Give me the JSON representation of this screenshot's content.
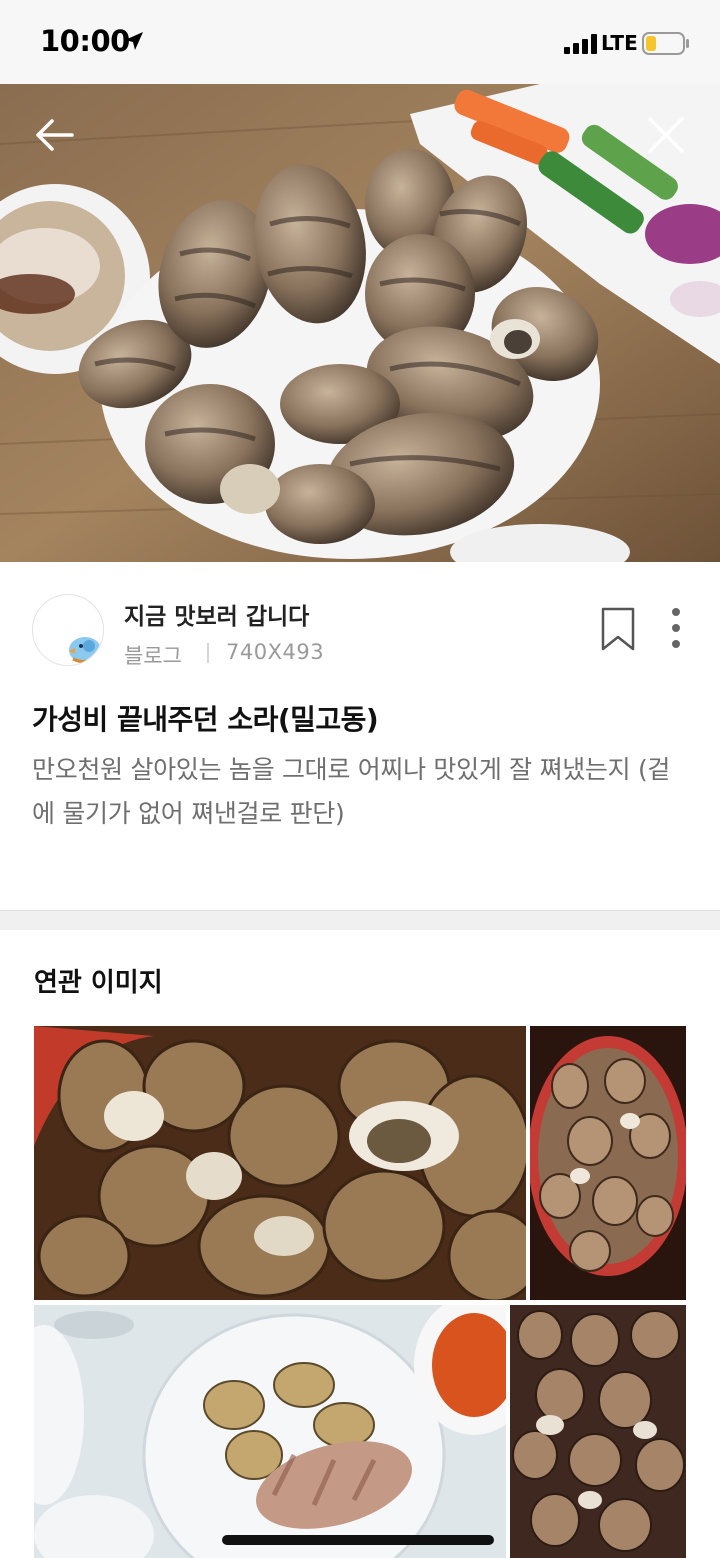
{
  "status_bar": {
    "time": "10:00",
    "network": "LTE",
    "battery_color": "#f6c42d"
  },
  "hero": {
    "back_icon": "arrow-left-icon",
    "close_icon": "close-icon"
  },
  "source": {
    "name": "지금 맛보러 갑니다",
    "type": "블로그",
    "image_size": "740X493",
    "bookmark_icon": "bookmark-icon",
    "more_icon": "more-vertical-icon"
  },
  "post": {
    "title": "가성비 끝내주던 소라(밀고동)",
    "description": "만오천원 살아있는 놈을 그대로 어찌나 맛있게 잘 쪄냈는지 (겉에 물기가 없어 쪄낸걸로 판단)"
  },
  "related": {
    "title": "연관 이미지"
  }
}
